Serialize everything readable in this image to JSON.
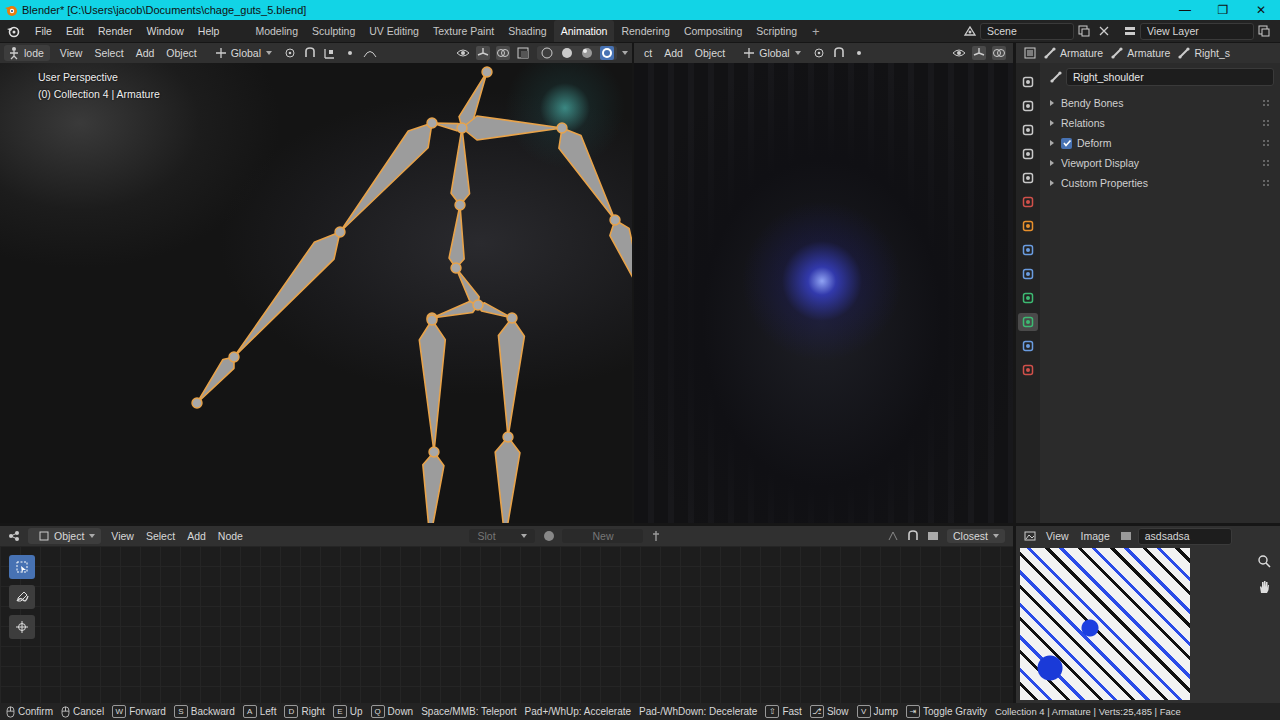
{
  "window": {
    "title": "Blender* [C:\\Users\\jacob\\Documents\\chage_guts_5.blend]",
    "controls": [
      "—",
      "❐",
      "✕"
    ]
  },
  "menus": [
    "File",
    "Edit",
    "Render",
    "Window",
    "Help"
  ],
  "workspaces": [
    {
      "label": "Modeling",
      "selected": false
    },
    {
      "label": "Sculpting",
      "selected": false
    },
    {
      "label": "UV Editing",
      "selected": false
    },
    {
      "label": "Texture Paint",
      "selected": false
    },
    {
      "label": "Shading",
      "selected": false
    },
    {
      "label": "Animation",
      "selected": true
    },
    {
      "label": "Rendering",
      "selected": false
    },
    {
      "label": "Compositing",
      "selected": false
    },
    {
      "label": "Scripting",
      "selected": false
    }
  ],
  "add_workspace": "+",
  "scene": "Scene",
  "view_layer": "View Layer",
  "viewport_left": {
    "mode": "lode",
    "menus": [
      "View",
      "Select",
      "Add",
      "Object"
    ],
    "orientation": "Global",
    "overlay_lines": [
      "User Perspective",
      "(0) Collection 4 | Armature"
    ]
  },
  "viewport_right": {
    "menus": [
      "ct",
      "Add",
      "Object"
    ],
    "orientation": "Global"
  },
  "properties": {
    "breadcrumb": [
      "Armature",
      "Armature",
      "Right_s"
    ],
    "bone_name": "Right_shoulder",
    "tabs": [
      {
        "color": "#c8c8c8",
        "selected": false
      },
      {
        "color": "#c8c8c8",
        "selected": false
      },
      {
        "color": "#c8c8c8",
        "selected": false
      },
      {
        "color": "#c8c8c8",
        "selected": false
      },
      {
        "color": "#c8c8c8",
        "selected": false
      },
      {
        "color": "#d0504a",
        "selected": false
      },
      {
        "color": "#e8902c",
        "selected": false
      },
      {
        "color": "#6a9ce0",
        "selected": false
      },
      {
        "color": "#6a9ce0",
        "selected": false
      },
      {
        "color": "#3dba72",
        "selected": false
      },
      {
        "color": "#3dba72",
        "selected": true
      },
      {
        "color": "#6a9ce0",
        "selected": false
      },
      {
        "color": "#d0504a",
        "selected": false
      }
    ],
    "panels": [
      {
        "label": "Bendy Bones",
        "kind": "panel",
        "expanded": false,
        "checked": false
      },
      {
        "label": "Relations",
        "kind": "panel",
        "expanded": false,
        "checked": false
      },
      {
        "label": "Deform",
        "kind": "checkbox",
        "expanded": false,
        "checked": true
      },
      {
        "label": "Viewport Display",
        "kind": "panel",
        "expanded": false,
        "checked": false
      },
      {
        "label": "Custom Properties",
        "kind": "panel",
        "expanded": false,
        "checked": false
      }
    ]
  },
  "node_editor": {
    "object_menu": "Object",
    "menus": [
      "View",
      "Select",
      "Add",
      "Node"
    ],
    "slot": "Slot",
    "new": "New",
    "interpolation": "Closest",
    "tools": [
      {
        "selected": true
      },
      {
        "selected": false
      },
      {
        "selected": false
      }
    ]
  },
  "image_editor": {
    "menus": [
      "View",
      "Image"
    ],
    "image": "asdsadsa"
  },
  "status_bar": {
    "hints": [
      {
        "kind": "mouse",
        "key": "",
        "label": "Confirm"
      },
      {
        "kind": "mouse",
        "key": "",
        "label": "Cancel"
      },
      {
        "kind": "key",
        "key": "W",
        "label": "Forward"
      },
      {
        "kind": "key",
        "key": "S",
        "label": "Backward"
      },
      {
        "kind": "key",
        "key": "A",
        "label": "Left"
      },
      {
        "kind": "key",
        "key": "D",
        "label": "Right"
      },
      {
        "kind": "key",
        "key": "E",
        "label": "Up"
      },
      {
        "kind": "key",
        "key": "Q",
        "label": "Down"
      },
      {
        "kind": "text",
        "key": "",
        "label": "Space/MMB: Teleport"
      },
      {
        "kind": "text",
        "key": "",
        "label": "Pad+/WhUp: Accelerate"
      },
      {
        "kind": "text",
        "key": "",
        "label": "Pad-/WhDown: Decelerate"
      },
      {
        "kind": "key",
        "key": "⇧",
        "label": "Fast"
      },
      {
        "kind": "key",
        "key": "⎇",
        "label": "Slow"
      },
      {
        "kind": "key",
        "key": "V",
        "label": "Jump"
      },
      {
        "kind": "key",
        "key": "⇥",
        "label": "Toggle Gravity"
      }
    ],
    "stats": "Collection 4 | Armature | Verts:25,485 | Face"
  }
}
